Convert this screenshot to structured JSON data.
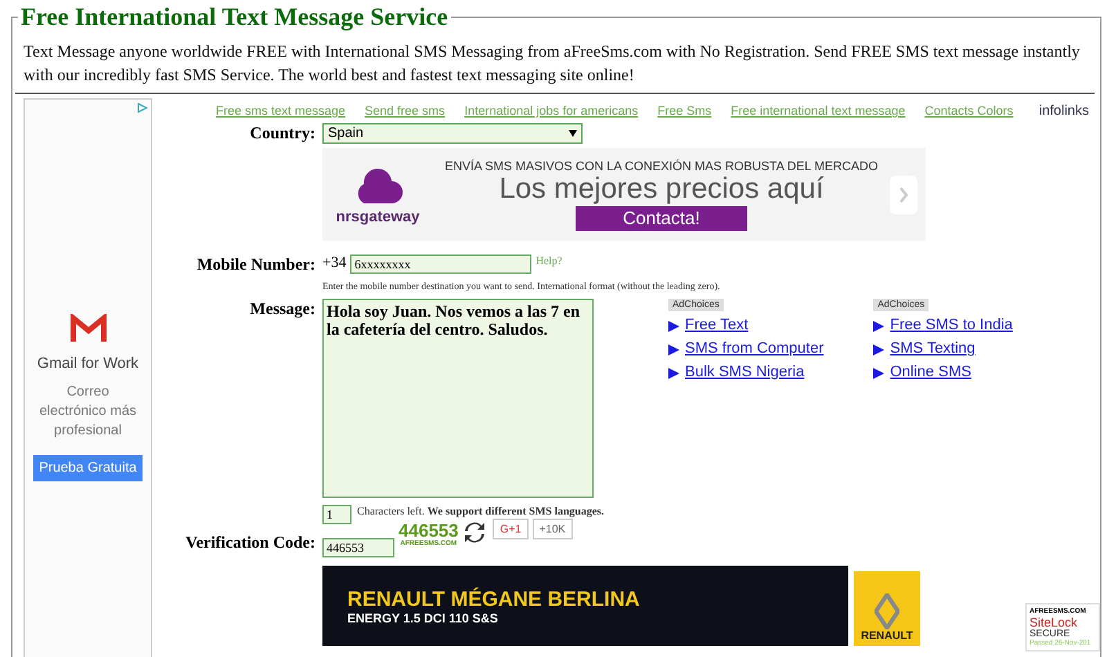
{
  "header": {
    "title": "Free International Text Message Service",
    "description": "Text Message anyone worldwide FREE with International SMS Messaging from aFreeSms.com with No Registration. Send FREE SMS text message instantly with our incredibly fast SMS Service. The world best and fastest text messaging site online!"
  },
  "nav_links": [
    "Free sms text message",
    "Send free sms",
    "International jobs for americans",
    "Free Sms",
    "Free international text message",
    "Contacts Colors"
  ],
  "infolinks": "infolinks",
  "side_ad": {
    "title": "Gmail for Work",
    "text": "Correo electrónico más profesional",
    "button": "Prueba Gratuita"
  },
  "country": {
    "label": "Country:",
    "value": "Spain"
  },
  "banner_ad": {
    "brand": "nrsgateway",
    "headline": "ENVÍA SMS MASIVOS CON LA CONEXIÓN MAS ROBUSTA DEL MERCADO",
    "tagline": "Los mejores precios aquí",
    "button": "Contacta!"
  },
  "mobile": {
    "label": "Mobile Number:",
    "prefix": "+34",
    "value": "6xxxxxxxx",
    "help": "Help?",
    "hint": "Enter the mobile number destination you want to send. International format (without the leading zero)."
  },
  "message": {
    "label": "Message:",
    "value": "Hola soy Juan. Nos vemos a las 7 en la cafetería del centro. Saludos."
  },
  "ad_links": [
    {
      "badge": "AdChoices",
      "links": [
        "Free Text",
        "SMS from Computer",
        "Bulk SMS Nigeria"
      ]
    },
    {
      "badge": "AdChoices",
      "links": [
        "Free SMS to India",
        "SMS Texting",
        "Online SMS"
      ]
    }
  ],
  "chars_left": {
    "value": "1",
    "text": "Characters left. **We support different SMS languages.**"
  },
  "verification": {
    "label": "Verification Code:",
    "value": "446553",
    "captcha_code": "446553",
    "captcha_site": "AFREESMS.COM",
    "gplus": "G+1",
    "count": "+10K"
  },
  "bottom_ad": {
    "headline": "RENAULT MÉGANE BERLINA",
    "subline": "ENERGY 1.5 DCI 110 S&S",
    "brand": "RENAULT"
  },
  "sitelock": {
    "site": "AFREESMS.COM",
    "brand": "SiteLock",
    "secure": "SECURE",
    "status": "Passed",
    "date": "26-Nov-201"
  }
}
